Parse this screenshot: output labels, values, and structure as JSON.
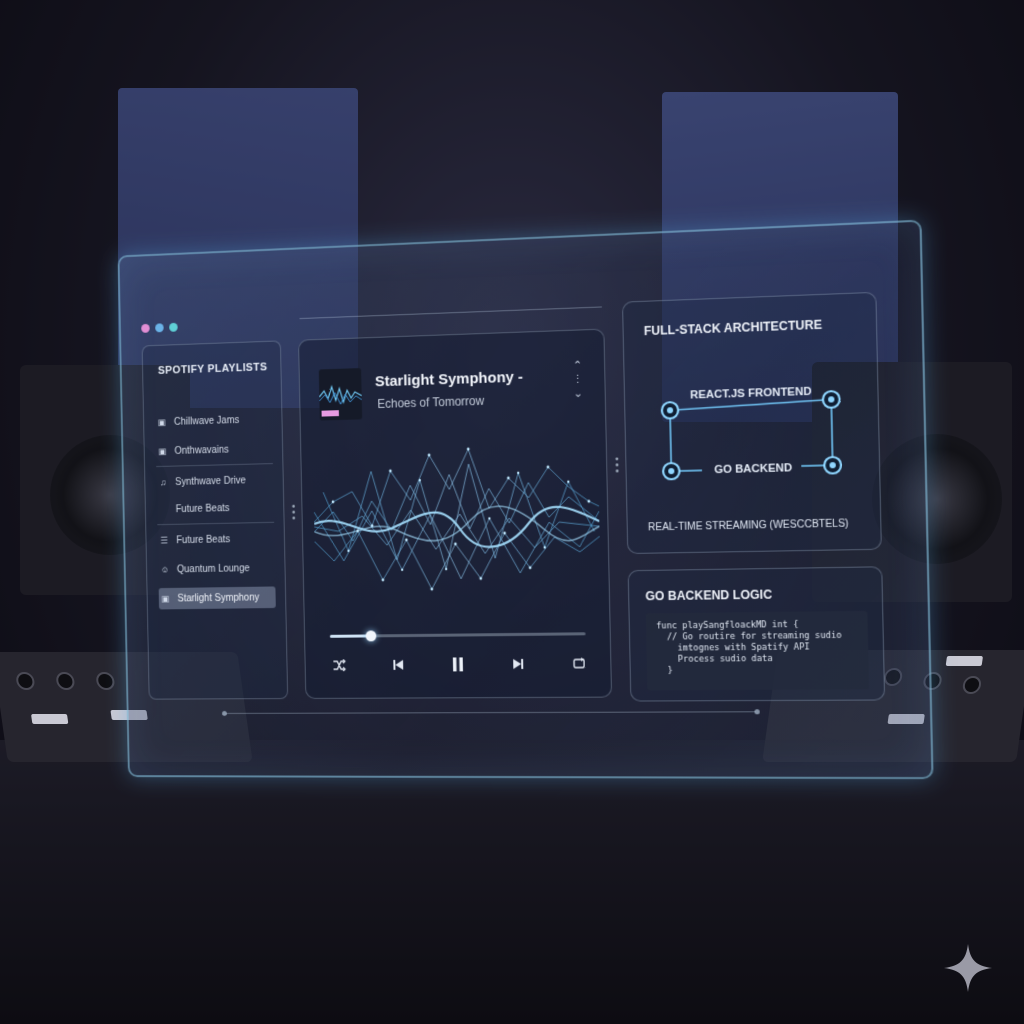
{
  "sidebar": {
    "title": "SPOTIFY PLAYLISTS",
    "items": [
      {
        "label": "Chillwave Jams",
        "icon": "lock-icon"
      },
      {
        "label": "Onthwavains",
        "icon": "lock-icon"
      },
      {
        "label": "Synthwave Drive",
        "icon": "music-note-icon"
      },
      {
        "label": "Future Beats",
        "icon": ""
      },
      {
        "label": "Future Beats",
        "icon": "list-icon"
      },
      {
        "label": "Quantum Lounge",
        "icon": "smiley-icon"
      },
      {
        "label": "Starlight Symphony",
        "icon": "lock-icon",
        "active": true
      }
    ]
  },
  "player": {
    "title": "Starlight Symphony -",
    "subtitle": "Echoes of Tomorrow",
    "progress_fraction": 0.16,
    "controls": [
      "shuffle-icon",
      "previous-icon",
      "pause-icon",
      "next-icon",
      "repeat-icon"
    ],
    "accent": "#e79be0"
  },
  "architecture": {
    "title": "FULL-STACK ARCHITECTURE",
    "frontend_label": "REACT.JS FRONTEND",
    "backend_label": "GO BACKEND",
    "footer": "REAL-TIME STREAMING (WESCCBTELS)",
    "node_color": "#6fc2f2"
  },
  "go_backend": {
    "title": "GO BACKEND LOGIC",
    "code": [
      "func playSangfloackMD int {",
      "  // Go routire for streaming sudio",
      "    imtognes with Spatify API",
      "    Process sudio data",
      "  }"
    ]
  },
  "window": {
    "dot_colors": [
      "#e28ed4",
      "#6ab3e8",
      "#5fd0d6"
    ]
  }
}
